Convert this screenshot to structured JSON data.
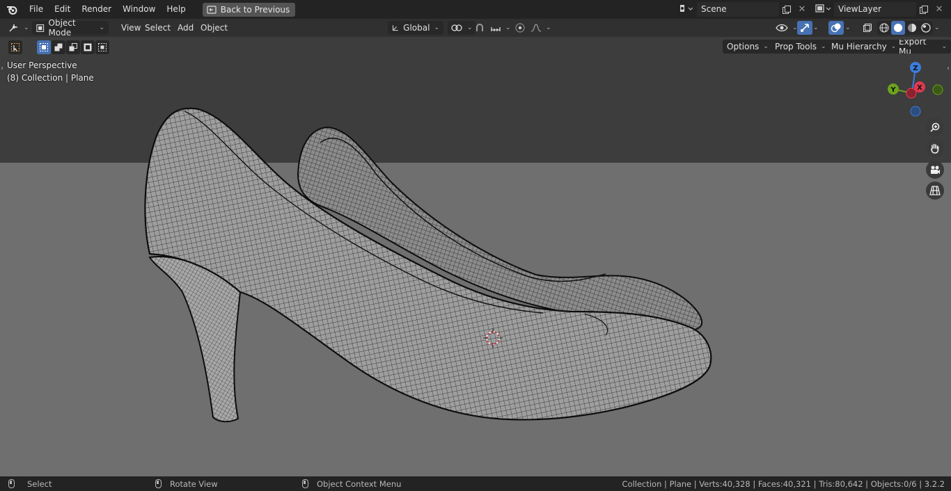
{
  "topbar": {
    "menus": [
      "File",
      "Edit",
      "Render",
      "Window",
      "Help"
    ],
    "back_label": "Back to Previous",
    "scene_name": "Scene",
    "view_layer": "ViewLayer"
  },
  "header": {
    "mode": "Object Mode",
    "menus": [
      "View",
      "Select",
      "Add",
      "Object"
    ],
    "transform_orientation": "Global"
  },
  "viewport": {
    "perspective_label": "User Perspective",
    "collection_label": "(8) Collection | Plane",
    "dropdowns": [
      "Options",
      "Prop Tools",
      "Mu Hierarchy",
      "Export Mu"
    ],
    "gizmo": {
      "x": "X",
      "y": "Y",
      "z": "Z"
    },
    "colors": {
      "x_axis": "#e0384f",
      "y_axis": "#6ba31c",
      "z_axis": "#3b7ddc",
      "accent": "#4772b3"
    }
  },
  "status": {
    "select": "Select",
    "rotate": "Rotate View",
    "context_menu": "Object Context Menu",
    "stats": "Collection | Plane | Verts:40,328 | Faces:40,321 | Tris:80,642 | Objects:0/6 | 3.2.2"
  },
  "icons": [
    "blender-logo",
    "back-icon",
    "scene-icon",
    "new-icon",
    "close-icon",
    "view-layer-icon",
    "editor-type-icon",
    "object-mode-icon",
    "orientation-icon",
    "pivot-icon",
    "snap-icon",
    "snap-increment-icon",
    "proportional-icon",
    "falloff-icon",
    "visibility-icon",
    "gizmo-icon",
    "overlay-icon",
    "xray-icon",
    "shading-wireframe-icon",
    "shading-solid-icon",
    "shading-material-icon",
    "shading-rendered-icon",
    "select-box-icon",
    "zoom-icon",
    "hand-icon",
    "camera-icon",
    "grid-icon",
    "mouse-icon"
  ]
}
